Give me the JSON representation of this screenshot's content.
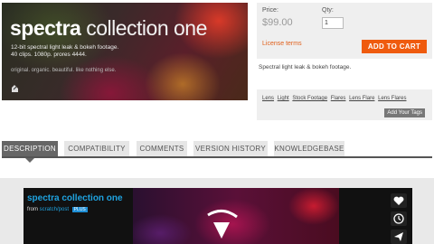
{
  "hero": {
    "title_bold": "spectra",
    "title_light": "collection one",
    "line1": "12-bit spectral light leak & bokeh footage.",
    "line2": "40 clips. 1080p. prores 4444.",
    "tagline": "original. organic. beautiful. like nothing else.",
    "logo_icon": "scratchpost-logo-icon"
  },
  "purchase": {
    "price_label": "Price:",
    "price_value": "$99.00",
    "qty_label": "Qty:",
    "qty_value": "1",
    "license_link": "License terms",
    "add_to_cart": "ADD TO CART",
    "accent_color": "#ef5b0e"
  },
  "description": "Spectral light leak & bokeh footage.",
  "tags": {
    "items": [
      "Lens",
      "Light",
      "Stock Footage",
      "Flares",
      "Lens Flare",
      "Lens Flares"
    ],
    "add_button": "Add Your Tags"
  },
  "tabs": [
    {
      "label": "DESCRIPTION",
      "active": true
    },
    {
      "label": "COMPATIBILITY",
      "active": false
    },
    {
      "label": "COMMENTS",
      "active": false
    },
    {
      "label": "VERSION HISTORY",
      "active": false
    },
    {
      "label": "KNOWLEDGEBASE",
      "active": false
    }
  ],
  "player": {
    "title": "spectra collection one",
    "from_prefix": "from",
    "author": "scratch/post",
    "badge": "PLUS",
    "side_icons": [
      "heart-icon",
      "clock-icon",
      "send-icon"
    ]
  }
}
